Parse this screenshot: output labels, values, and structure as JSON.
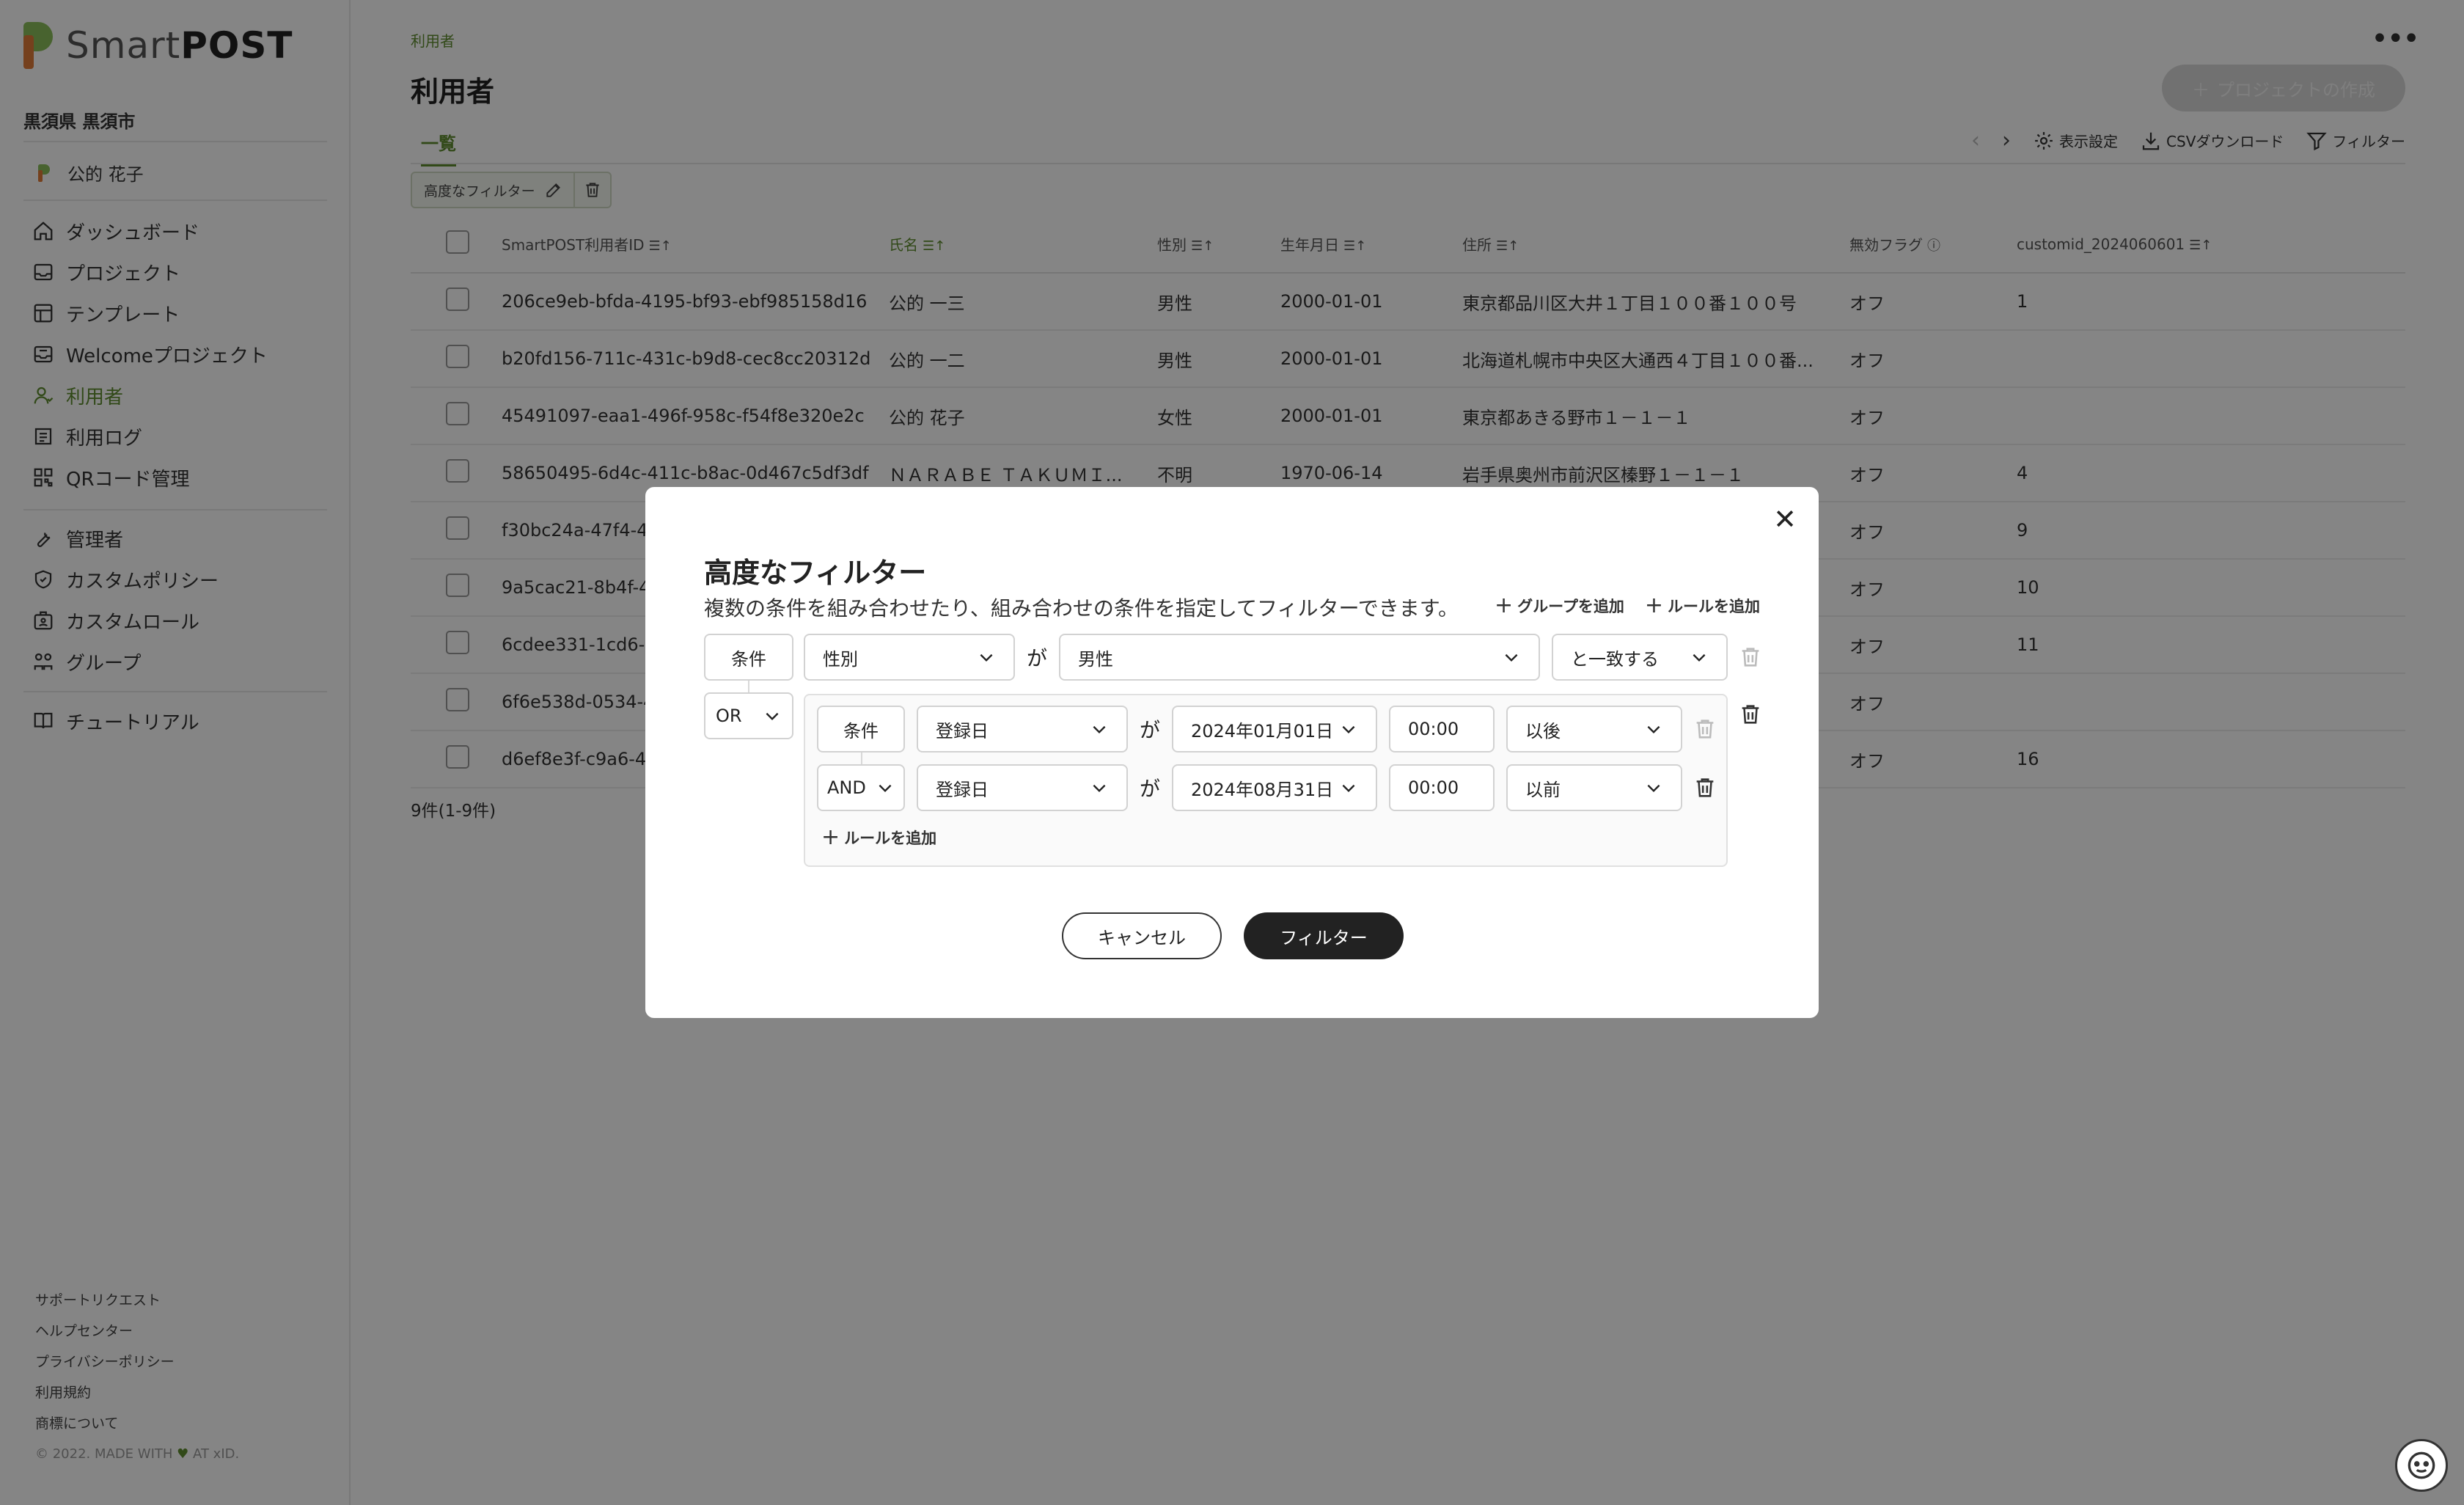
{
  "app": {
    "logo_light": "Smart",
    "logo_bold": "POST",
    "org_name": "黒須県 黒須市",
    "current_user": "公的 花子"
  },
  "sidebar": {
    "nav_main": [
      {
        "label": "ダッシュボード",
        "icon": "home-icon",
        "active": false
      },
      {
        "label": "プロジェクト",
        "icon": "project-icon",
        "active": false
      },
      {
        "label": "テンプレート",
        "icon": "template-icon",
        "active": false
      },
      {
        "label": "Welcomeプロジェクト",
        "icon": "welcome-project-icon",
        "active": false
      },
      {
        "label": "利用者",
        "icon": "user-icon",
        "active": true
      },
      {
        "label": "利用ログ",
        "icon": "log-icon",
        "active": false
      },
      {
        "label": "QRコード管理",
        "icon": "qr-icon",
        "active": false
      }
    ],
    "nav_admin": [
      {
        "label": "管理者",
        "icon": "wrench-icon"
      },
      {
        "label": "カスタムポリシー",
        "icon": "shield-icon"
      },
      {
        "label": "カスタムロール",
        "icon": "badge-icon"
      },
      {
        "label": "グループ",
        "icon": "group-icon"
      }
    ],
    "nav_help": [
      {
        "label": "チュートリアル",
        "icon": "book-icon"
      }
    ],
    "footer_links": [
      "サポートリクエスト",
      "ヘルプセンター",
      "プライバシーポリシー",
      "利用規約",
      "商標について"
    ],
    "copyright_prefix": "© 2022. MADE WITH",
    "copyright_suffix": "AT xID."
  },
  "header": {
    "breadcrumb": "利用者",
    "title": "利用者",
    "create_button": "プロジェクトの作成",
    "tab": "一覧",
    "display_settings": "表示設定",
    "csv_download": "CSVダウンロード",
    "filter": "フィルター",
    "active_filter_chip": "高度なフィルター"
  },
  "table": {
    "columns": [
      "SmartPOST利用者ID",
      "氏名",
      "性別",
      "生年月日",
      "住所",
      "無効フラグ",
      "customid_2024060601"
    ],
    "rows": [
      [
        "206ce9eb-bfda-4195-bf93-ebf985158d16",
        "公的 一三",
        "男性",
        "2000-01-01",
        "東京都品川区大井１丁目１００番１００号",
        "オフ",
        "1"
      ],
      [
        "b20fd156-711c-431c-b9d8-cec8cc20312d",
        "公的 一二",
        "男性",
        "2000-01-01",
        "北海道札幌市中央区大通西４丁目１００番...",
        "オフ",
        ""
      ],
      [
        "45491097-eaa1-496f-958c-f54f8e320e2c",
        "公的 花子",
        "女性",
        "2000-01-01",
        "東京都あきる野市１－１－１",
        "オフ",
        ""
      ],
      [
        "58650495-6d4c-411c-b8ac-0d467c5df3df",
        "ＮＡＲＡＢＥ ＴＡＫＵＭＩ...",
        "不明",
        "1970-06-14",
        "岩手県奥州市前沢区榛野１－１－１",
        "オフ",
        "4"
      ],
      [
        "f30bc24a-47f4-41",
        "",
        "",
        "",
        "",
        "オフ",
        "9"
      ],
      [
        "9a5cac21-8b4f-47",
        "",
        "",
        "",
        "",
        "オフ",
        "10"
      ],
      [
        "6cdee331-1cd6-4f",
        "",
        "",
        "",
        "",
        "オフ",
        "11"
      ],
      [
        "6f6e538d-0534-4b",
        "",
        "",
        "",
        "",
        "オフ",
        ""
      ],
      [
        "d6ef8e3f-c9a6-46",
        "",
        "",
        "",
        "",
        "オフ",
        "16"
      ]
    ],
    "count_label": "9件(1-9件)"
  },
  "modal": {
    "title": "高度なフィルター",
    "description": "複数の条件を組み合わせたり、組み合わせの条件を指定してフィルターできます。",
    "add_group": "グループを追加",
    "add_rule": "ルールを追加",
    "rule1": {
      "label": "条件",
      "field": "性別",
      "ga": "が",
      "value": "男性",
      "op": "と一致する"
    },
    "group_logic": "OR",
    "group_rule1": {
      "label": "条件",
      "field": "登録日",
      "ga": "が",
      "date": "2024年01月01日",
      "time": "00:00",
      "op": "以後"
    },
    "group_rule2": {
      "logic": "AND",
      "field": "登録日",
      "ga": "が",
      "date": "2024年08月31日",
      "time": "00:00",
      "op": "以前"
    },
    "inner_add_rule": "ルールを追加",
    "cancel": "キャンセル",
    "apply": "フィルター"
  },
  "colors": {
    "accent": "#5f8c2e",
    "overlay": "rgba(0,0,0,0.48)",
    "primary_button": "#222222"
  }
}
